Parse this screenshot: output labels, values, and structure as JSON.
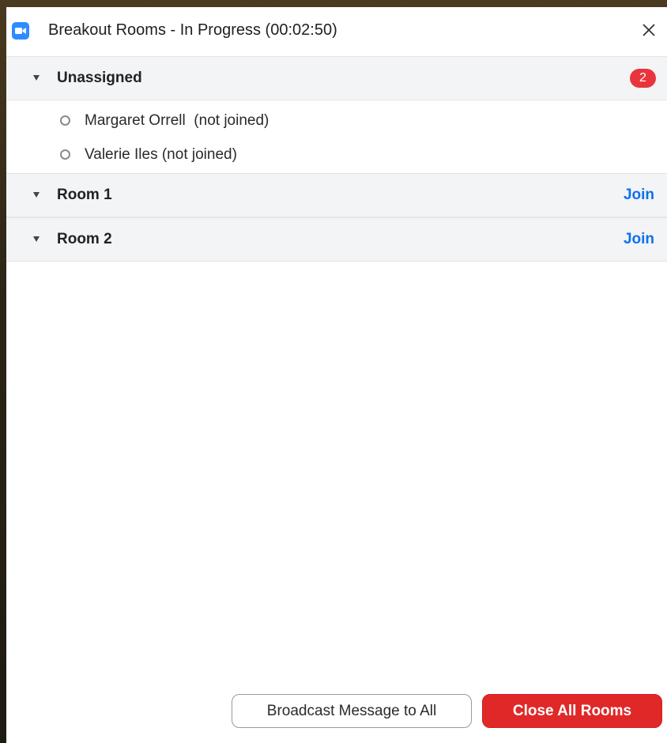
{
  "window": {
    "title": "Breakout Rooms - In Progress (00:02:50)",
    "app_icon": "zoom-camera-icon",
    "close_icon": "close-icon"
  },
  "sections": [
    {
      "label": "Unassigned",
      "badge": "2",
      "participants": [
        {
          "name": "Margaret Orrell  (not joined)"
        },
        {
          "name": "Valerie Iles (not joined)"
        }
      ]
    },
    {
      "label": "Room 1",
      "action": "Join"
    },
    {
      "label": "Room 2",
      "action": "Join"
    }
  ],
  "footer": {
    "broadcast_label": "Broadcast Message to All",
    "close_all_label": "Close All Rooms"
  },
  "colors": {
    "accent_blue": "#0e71eb",
    "danger_red": "#e02828",
    "badge_red": "#e8353b",
    "header_gray": "#f3f4f6"
  }
}
